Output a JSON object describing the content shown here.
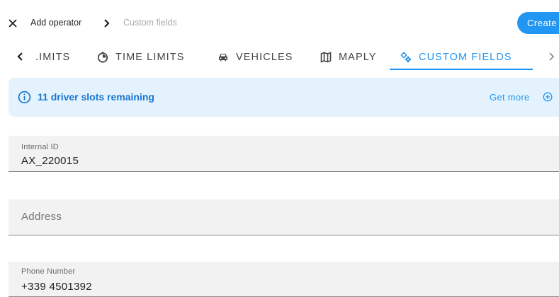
{
  "header": {
    "close_icon": "close-icon",
    "breadcrumb": {
      "parent": "Add operator",
      "current": "Custom fields"
    },
    "create_label": "Create"
  },
  "tabs": {
    "items": [
      {
        "label": ".IMITS",
        "icon": ""
      },
      {
        "label": "TIME LIMITS",
        "icon": "time-limit-icon"
      },
      {
        "label": "VEHICLES",
        "icon": "car-icon"
      },
      {
        "label": "MAPLY",
        "icon": "map-icon"
      },
      {
        "label": "CUSTOM FIELDS",
        "icon": "gears-icon",
        "active": true
      }
    ]
  },
  "alert": {
    "message": "11 driver slots remaining",
    "action": "Get more"
  },
  "fields": [
    {
      "label": "Internal ID",
      "value": "AX_220015"
    },
    {
      "placeholder": "Address"
    },
    {
      "label": "Phone Number",
      "value": "+339 4501392"
    }
  ],
  "colors": {
    "accent": "#2196f3",
    "alert_bg": "#e3f2fd",
    "field_bg": "#f2f2f2"
  }
}
